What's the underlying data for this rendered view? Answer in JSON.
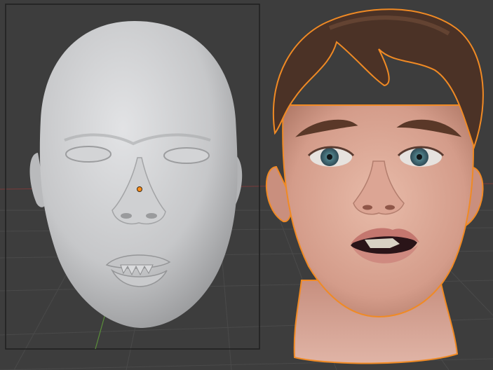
{
  "app": "3D viewport",
  "viewport": {
    "background": "#3d3d3d",
    "grid_color": "#4a4a4a",
    "axis_x_color": "#7a3a3a",
    "axis_y_color": "#5a8f3a",
    "camera_frame_color": "#1f1f1f"
  },
  "objects": [
    {
      "name": "sculpt-head",
      "material": "clay",
      "color": "#c9cacc",
      "selected": false
    },
    {
      "name": "textured-head",
      "material": "skin",
      "color": "#d9a494",
      "selected": true,
      "outline_color": "#f08a24"
    }
  ],
  "origin_point": {
    "color": "#ff8c1a"
  }
}
